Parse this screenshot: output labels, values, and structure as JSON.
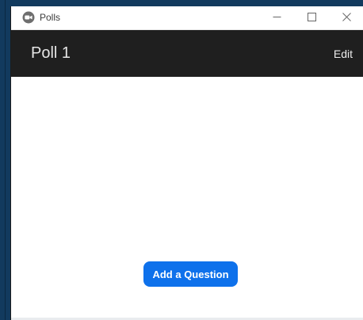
{
  "window": {
    "title": "Polls",
    "icon": "zoom-polls-icon",
    "controls": [
      "minimize-icon",
      "maximize-icon",
      "close-icon"
    ]
  },
  "header": {
    "poll_title": "Poll 1",
    "edit_label": "Edit"
  },
  "main": {
    "add_question_label": "Add a Question"
  },
  "colors": {
    "accent": "#0e71eb",
    "header_bg": "#1f1f1f",
    "desktop_bg": "#123a5e"
  }
}
